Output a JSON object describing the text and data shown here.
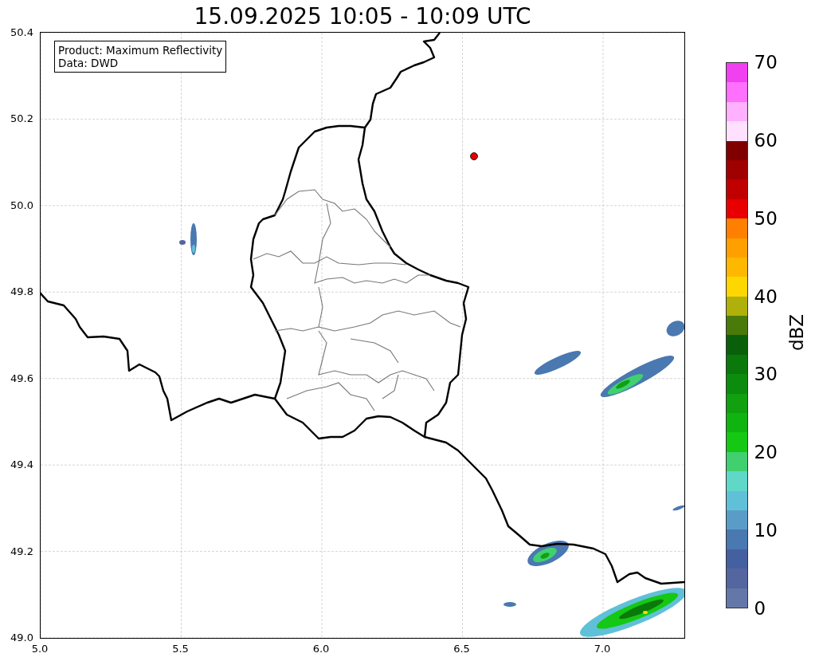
{
  "title": "15.09.2025 10:05 - 10:09 UTC",
  "map": {
    "legend": [
      "Product: Maximum Reflectivity",
      "Data: DWD"
    ],
    "x_ticks": [
      "5.0",
      "5.5",
      "6.0",
      "6.5",
      "7.0"
    ],
    "y_ticks": [
      "50.4",
      "50.2",
      "50.0",
      "49.8",
      "49.6",
      "49.4",
      "49.2",
      "49.0"
    ]
  },
  "colorbar": {
    "label": "dBZ",
    "ticks": [
      "70",
      "60",
      "50",
      "40",
      "30",
      "20",
      "10",
      "0"
    ],
    "segments": [
      {
        "color": "#f040f0"
      },
      {
        "color": "#ff70ff"
      },
      {
        "color": "#ffb0ff"
      },
      {
        "color": "#ffe0ff"
      },
      {
        "color": "#800000"
      },
      {
        "color": "#a00000"
      },
      {
        "color": "#c00000"
      },
      {
        "color": "#e80000"
      },
      {
        "color": "#ff8000"
      },
      {
        "color": "#ffa000"
      },
      {
        "color": "#ffb800"
      },
      {
        "color": "#ffd700"
      },
      {
        "color": "#b0b00a"
      },
      {
        "color": "#4a7a0a"
      },
      {
        "color": "#0a600a"
      },
      {
        "color": "#0a780a"
      },
      {
        "color": "#0c8c0c"
      },
      {
        "color": "#10a010"
      },
      {
        "color": "#10b410"
      },
      {
        "color": "#14c814"
      },
      {
        "color": "#40d070"
      },
      {
        "color": "#60d8c8"
      },
      {
        "color": "#60c0d8"
      },
      {
        "color": "#5a9cc8"
      },
      {
        "color": "#4a78b0"
      },
      {
        "color": "#4560a0"
      },
      {
        "color": "#5565a0"
      },
      {
        "color": "#6577a8"
      }
    ]
  }
}
